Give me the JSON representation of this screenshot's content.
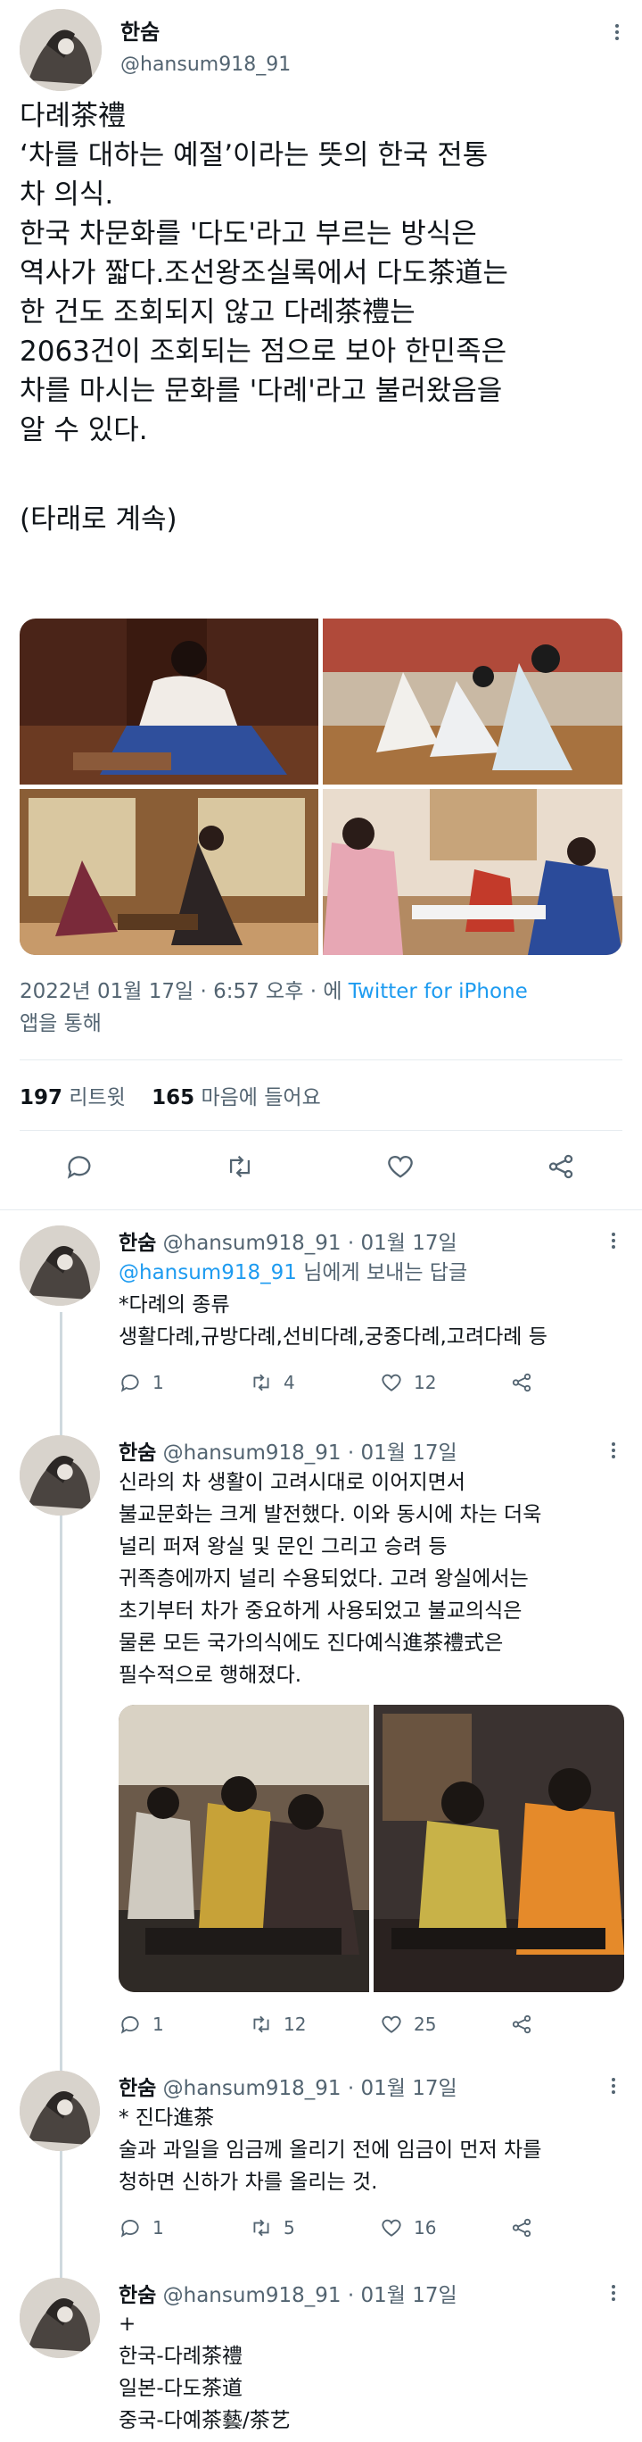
{
  "main": {
    "name": "한숨",
    "handle": "@hansum918_91",
    "text_lines": [
      "다례茶禮",
      "‘차를 대하는 예절’이라는 뜻의 한국 전통",
      "차 의식.",
      "한국 차문화를 '다도'라고 부르는 방식은",
      "역사가 짧다.조선왕조실록에서 다도茶道는",
      "한 건도 조회되지 않고 다례茶禮는",
      "2063건이 조회되는 점으로 보아 한민족은",
      "차를 마시는 문화를 '다례'라고 불러왔음을",
      "알 수 있다.",
      "",
      "(타래로 계속)"
    ],
    "meta_date": "2022년 01월 17일 · 6:57 오후 · 에",
    "meta_source": "Twitter for iPhone",
    "meta_suffix": "앱을 통해",
    "retweets_count": "197",
    "retweets_label": "리트윗",
    "likes_count": "165",
    "likes_label": "마음에 들어요"
  },
  "icons": {
    "reply": "reply-icon",
    "retweet": "retweet-icon",
    "like": "heart-icon",
    "share": "share-icon",
    "more": "more-icon"
  },
  "replies": [
    {
      "name": "한숨",
      "handle_time": "@hansum918_91 · 01월 17일",
      "reply_to": "@hansum918_91",
      "reply_to_suffix": "님에게 보내는 답글",
      "lines": [
        "*다례의 종류",
        "생활다례,규방다례,선비다례,궁중다례,고려다례 등"
      ],
      "reply_count": "1",
      "retweet_count": "4",
      "like_count": "12"
    },
    {
      "name": "한숨",
      "handle_time": "@hansum918_91 · 01월 17일",
      "lines": [
        "신라의 차 생활이 고려시대로 이어지면서",
        "불교문화는 크게 발전했다. 이와 동시에 차는 더욱",
        "널리 퍼져 왕실 및 문인 그리고 승려 등",
        "귀족층에까지 널리 수용되었다. 고려 왕실에서는",
        "초기부터 차가 중요하게 사용되었고 불교의식은",
        "물론 모든 국가의식에도 진다예식進茶禮式은",
        "필수적으로 행해졌다."
      ],
      "reply_count": "1",
      "retweet_count": "12",
      "like_count": "25"
    },
    {
      "name": "한숨",
      "handle_time": "@hansum918_91 · 01월 17일",
      "lines": [
        "* 진다進茶",
        "술과 과일을 임금께 올리기 전에 임금이 먼저 차를",
        "청하면 신하가 차를 올리는 것."
      ],
      "reply_count": "1",
      "retweet_count": "5",
      "like_count": "16"
    },
    {
      "name": "한숨",
      "handle_time": "@hansum918_91 · 01월 17일",
      "lines": [
        "+",
        "한국-다례茶禮",
        "일본-다도茶道",
        "중국-다예茶藝/茶艺"
      ]
    }
  ]
}
